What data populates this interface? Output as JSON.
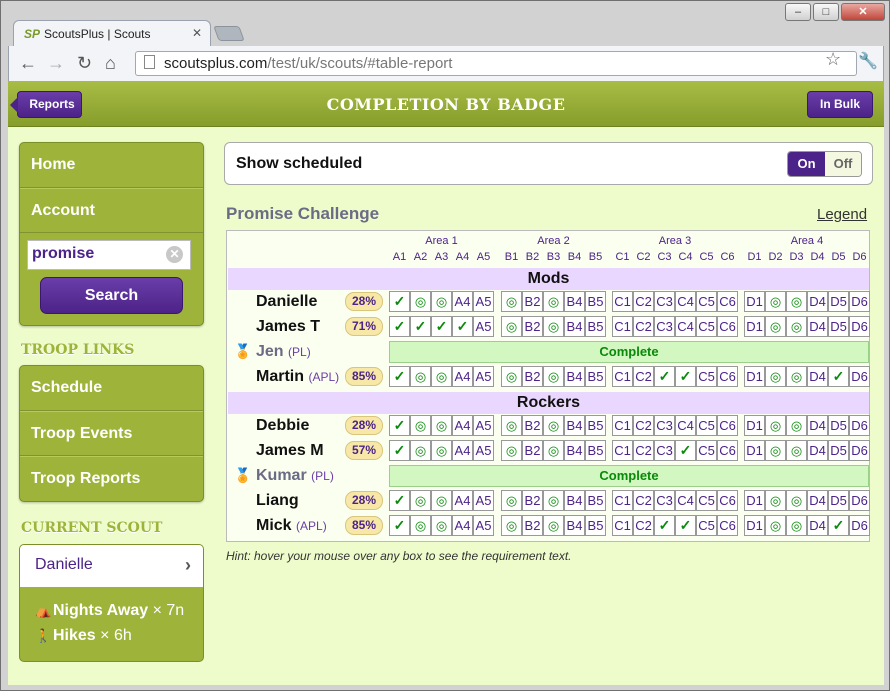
{
  "browser": {
    "tab_title": "ScoutsPlus | Scouts",
    "tab_logo": "SP",
    "url_host": "scoutsplus.com",
    "url_path": "/test/uk/scouts/#table-report",
    "window_buttons": [
      "–",
      "□",
      "✕"
    ]
  },
  "header": {
    "title": "COMPLETION BY BADGE",
    "back_label": "Reports",
    "bulk_label": "In Bulk"
  },
  "sidebar": {
    "menu": [
      "Home",
      "Account"
    ],
    "search_value": "promise",
    "search_label": "Search",
    "troop_links_title": "TROOP LINKS",
    "troop_links": [
      "Schedule",
      "Troop Events",
      "Troop Reports"
    ],
    "current_title": "CURRENT SCOUT",
    "current_name": "Danielle",
    "stats": [
      {
        "label": "Nights Away",
        "value": "× 7n",
        "icon": "tent-icon"
      },
      {
        "label": "Hikes",
        "value": "× 6h",
        "icon": "hiker-icon"
      }
    ]
  },
  "schedule": {
    "label": "Show scheduled",
    "on": "On",
    "off": "Off"
  },
  "report": {
    "title": "Promise Challenge",
    "legend": "Legend",
    "hint": "Hint: hover your mouse over any box to see the requirement text.",
    "areas": [
      {
        "label": "Area 1",
        "codes": [
          "A1",
          "A2",
          "A3",
          "A4",
          "A5"
        ]
      },
      {
        "label": "Area 2",
        "codes": [
          "B1",
          "B2",
          "B3",
          "B4",
          "B5"
        ]
      },
      {
        "label": "Area 3",
        "codes": [
          "C1",
          "C2",
          "C3",
          "C4",
          "C5",
          "C6"
        ]
      },
      {
        "label": "Area 4",
        "codes": [
          "D1",
          "D2",
          "D3",
          "D4",
          "D5",
          "D6"
        ]
      }
    ],
    "complete_label": "Complete",
    "groups": [
      {
        "name": "Mods",
        "scouts": [
          {
            "name": "Danielle",
            "role": "",
            "pct": "28%",
            "cells": [
              "c",
              "s",
              "s",
              "A4",
              "A5",
              "s",
              "B2",
              "s",
              "B4",
              "B5",
              "C1",
              "C2",
              "C3",
              "C4",
              "C5",
              "C6",
              "D1",
              "s",
              "s",
              "D4",
              "D5",
              "D6"
            ]
          },
          {
            "name": "James T",
            "role": "",
            "pct": "71%",
            "cells": [
              "c",
              "c",
              "c",
              "c",
              "A5",
              "s",
              "B2",
              "s",
              "B4",
              "B5",
              "C1",
              "C2",
              "C3",
              "C4",
              "C5",
              "C6",
              "D1",
              "s",
              "s",
              "D4",
              "D5",
              "D6"
            ]
          },
          {
            "name": "Jen",
            "role": "(PL)",
            "complete": true
          },
          {
            "name": "Martin",
            "role": "(APL)",
            "pct": "85%",
            "cells": [
              "c",
              "s",
              "s",
              "A4",
              "A5",
              "s",
              "B2",
              "s",
              "B4",
              "B5",
              "C1",
              "C2",
              "c",
              "c",
              "C5",
              "C6",
              "D1",
              "s",
              "s",
              "D4",
              "c",
              "D6"
            ]
          }
        ]
      },
      {
        "name": "Rockers",
        "scouts": [
          {
            "name": "Debbie",
            "role": "",
            "pct": "28%",
            "cells": [
              "c",
              "s",
              "s",
              "A4",
              "A5",
              "s",
              "B2",
              "s",
              "B4",
              "B5",
              "C1",
              "C2",
              "C3",
              "C4",
              "C5",
              "C6",
              "D1",
              "s",
              "s",
              "D4",
              "D5",
              "D6"
            ]
          },
          {
            "name": "James M",
            "role": "",
            "pct": "57%",
            "cells": [
              "c",
              "s",
              "s",
              "A4",
              "A5",
              "s",
              "B2",
              "s",
              "B4",
              "B5",
              "C1",
              "C2",
              "C3",
              "c",
              "C5",
              "C6",
              "D1",
              "s",
              "s",
              "D4",
              "D5",
              "D6"
            ]
          },
          {
            "name": "Kumar",
            "role": "(PL)",
            "complete": true
          },
          {
            "name": "Liang",
            "role": "",
            "pct": "28%",
            "cells": [
              "c",
              "s",
              "s",
              "A4",
              "A5",
              "s",
              "B2",
              "s",
              "B4",
              "B5",
              "C1",
              "C2",
              "C3",
              "C4",
              "C5",
              "C6",
              "D1",
              "s",
              "s",
              "D4",
              "D5",
              "D6"
            ]
          },
          {
            "name": "Mick",
            "role": "(APL)",
            "pct": "85%",
            "cells": [
              "c",
              "s",
              "s",
              "A4",
              "A5",
              "s",
              "B2",
              "s",
              "B4",
              "B5",
              "C1",
              "C2",
              "c",
              "c",
              "C5",
              "C6",
              "D1",
              "s",
              "s",
              "D4",
              "c",
              "D6"
            ]
          }
        ]
      }
    ]
  }
}
